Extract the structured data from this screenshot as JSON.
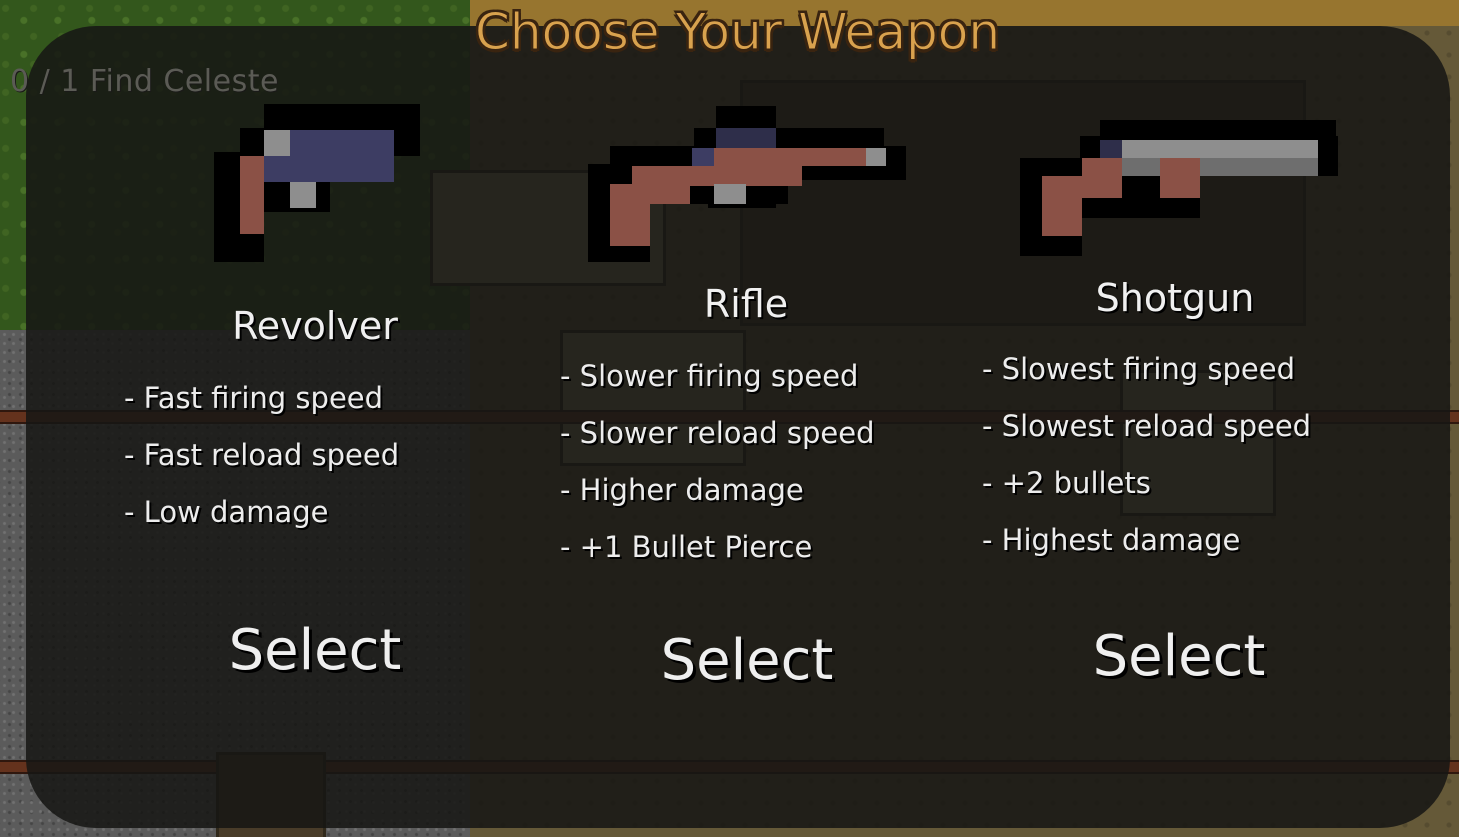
{
  "title": "Choose Your Weapon",
  "quest": {
    "progress": "0 / 1",
    "objective": "Find Celeste"
  },
  "weapons": [
    {
      "name": "Revolver",
      "stats": [
        "- Fast firing speed",
        "- Fast reload speed",
        "- Low damage"
      ],
      "select_label": "Select",
      "icon": "revolver-icon"
    },
    {
      "name": "Rifle",
      "stats": [
        "- Slower firing speed",
        "- Slower reload speed",
        "- Higher damage",
        "- +1 Bullet Pierce"
      ],
      "select_label": "Select",
      "icon": "rifle-icon"
    },
    {
      "name": "Shotgun",
      "stats": [
        "- Slowest firing speed",
        "- Slowest reload speed",
        "- +2 bullets",
        "- Highest damage"
      ],
      "select_label": "Select",
      "icon": "shotgun-icon"
    }
  ],
  "colors": {
    "title": "#d9a24e",
    "panel": "#161614",
    "text": "#ededed",
    "gun_stock": "#8b5146",
    "gun_metal": "#3a3a5a",
    "gun_steel": "#9a9a9a"
  }
}
